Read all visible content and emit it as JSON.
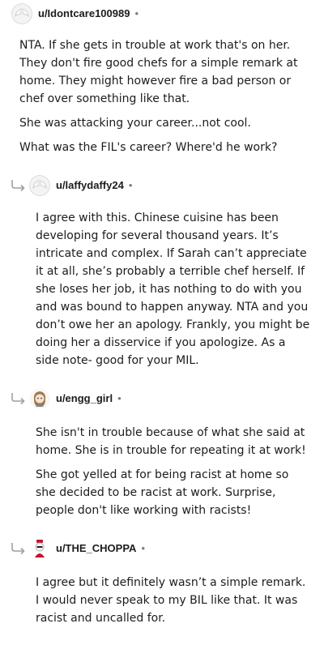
{
  "comments": [
    {
      "username": "u/Idontcare100989",
      "paragraphs": [
        "NTA. If she gets in trouble at work that's on her. They don't fire good chefs for a simple remark at home. They might however fire a bad person or chef over something like that.",
        "She was attacking your career...not cool.",
        "What was the FIL's career? Where'd he work?"
      ]
    },
    {
      "username": "u/laffydaffy24",
      "paragraphs": [
        "I agree with this. Chinese cuisine has been developing for several thousand years. It’s intricate and complex. If Sarah can’t appreciate it at all, she’s probably a terrible chef herself. If she loses her job, it has nothing to do with you and was bound to happen anyway. NTA and you don’t owe her an apology. Frankly, you might be doing her a disservice if you apologize. As a side note- good for your MIL."
      ]
    },
    {
      "username": "u/engg_girl",
      "paragraphs": [
        "She isn't in trouble because of what she said at home. She is in trouble for repeating it at work!",
        "She got yelled at for being racist at home so she decided to be racist at work. Surprise, people don't like working with racists!"
      ]
    },
    {
      "username": "u/THE_CHOPPA",
      "paragraphs": [
        "I agree but it definitely wasn’t a simple remark. I would never speak to my BIL like that. It was racist and uncalled for."
      ]
    }
  ],
  "separator": "•"
}
